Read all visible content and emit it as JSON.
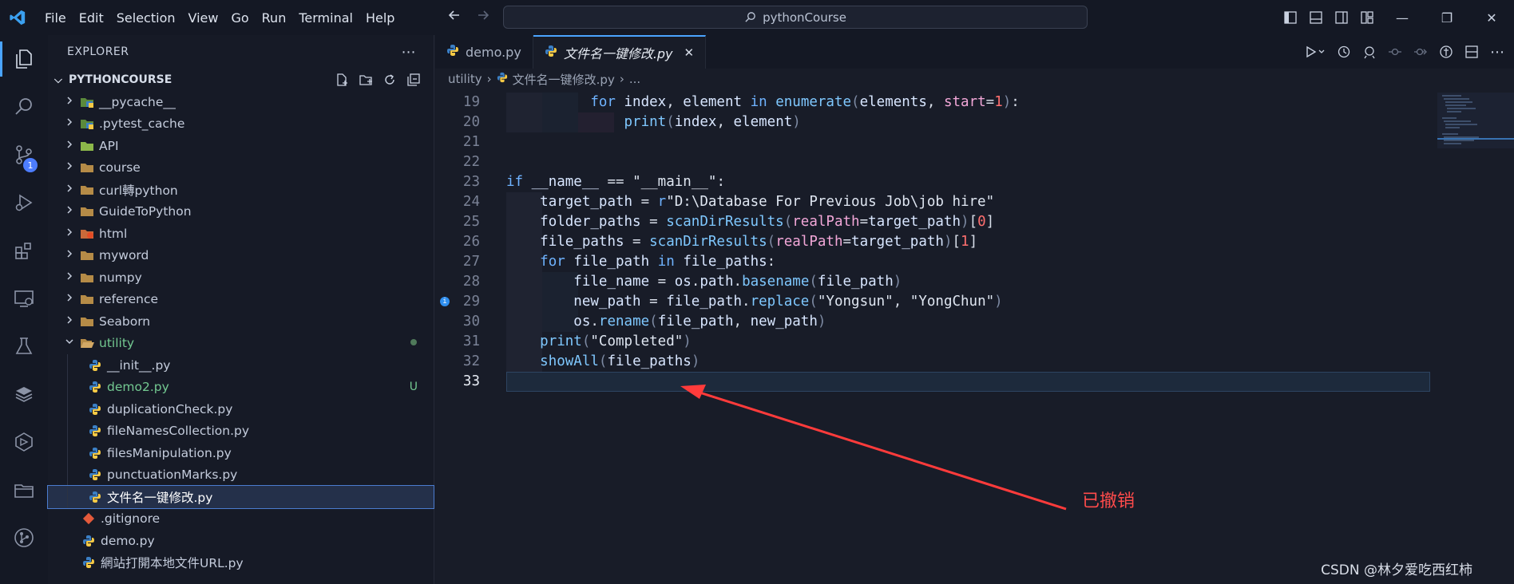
{
  "titlebar": {
    "menu": [
      "File",
      "Edit",
      "Selection",
      "View",
      "Go",
      "Run",
      "Terminal",
      "Help"
    ],
    "search_label": "pythonCourse"
  },
  "sidebar": {
    "title": "EXPLORER",
    "project": "PYTHONCOURSE",
    "items": [
      {
        "label": "__pycache__",
        "type": "folder",
        "icon": "python-folder-icon"
      },
      {
        "label": ".pytest_cache",
        "type": "folder",
        "icon": "python-folder-icon"
      },
      {
        "label": "API",
        "type": "folder",
        "icon": "api-folder-icon"
      },
      {
        "label": "course",
        "type": "folder",
        "icon": "folder-icon"
      },
      {
        "label": "curl轉python",
        "type": "folder",
        "icon": "folder-icon"
      },
      {
        "label": "GuideToPython",
        "type": "folder",
        "icon": "folder-icon"
      },
      {
        "label": "html",
        "type": "folder",
        "icon": "html-folder-icon"
      },
      {
        "label": "myword",
        "type": "folder",
        "icon": "folder-icon"
      },
      {
        "label": "numpy",
        "type": "folder",
        "icon": "folder-icon"
      },
      {
        "label": "reference",
        "type": "folder",
        "icon": "folder-icon"
      },
      {
        "label": "Seaborn",
        "type": "folder",
        "icon": "folder-icon"
      },
      {
        "label": "utility",
        "type": "folder-open",
        "icon": "folder-open-icon"
      },
      {
        "label": "__init__.py",
        "type": "file"
      },
      {
        "label": "demo2.py",
        "type": "file",
        "status": "U"
      },
      {
        "label": "duplicationCheck.py",
        "type": "file"
      },
      {
        "label": "fileNamesCollection.py",
        "type": "file"
      },
      {
        "label": "filesManipulation.py",
        "type": "file"
      },
      {
        "label": "punctuationMarks.py",
        "type": "file"
      },
      {
        "label": "文件名一键修改.py",
        "type": "file",
        "selected": true
      },
      {
        "label": ".gitignore",
        "type": "root-git"
      },
      {
        "label": "demo.py",
        "type": "root-file"
      },
      {
        "label": "網站打開本地文件URL.py",
        "type": "root-file"
      }
    ]
  },
  "editor": {
    "tabs": [
      {
        "label": "demo.py"
      },
      {
        "label": "文件名一键修改.py",
        "active": true,
        "close": "✕"
      }
    ],
    "breadcrumb": [
      "utility",
      "文件名一键修改.py",
      "..."
    ],
    "line_numbers": [
      "19",
      "20",
      "21",
      "22",
      "23",
      "24",
      "25",
      "26",
      "27",
      "28",
      "29",
      "30",
      "31",
      "32",
      "33"
    ]
  },
  "annotation": "已撤销",
  "watermark": "CSDN @林夕爱吃西红柿",
  "colors": {
    "accent": "#4aa4ff",
    "arrow": "#ff3b3b"
  }
}
